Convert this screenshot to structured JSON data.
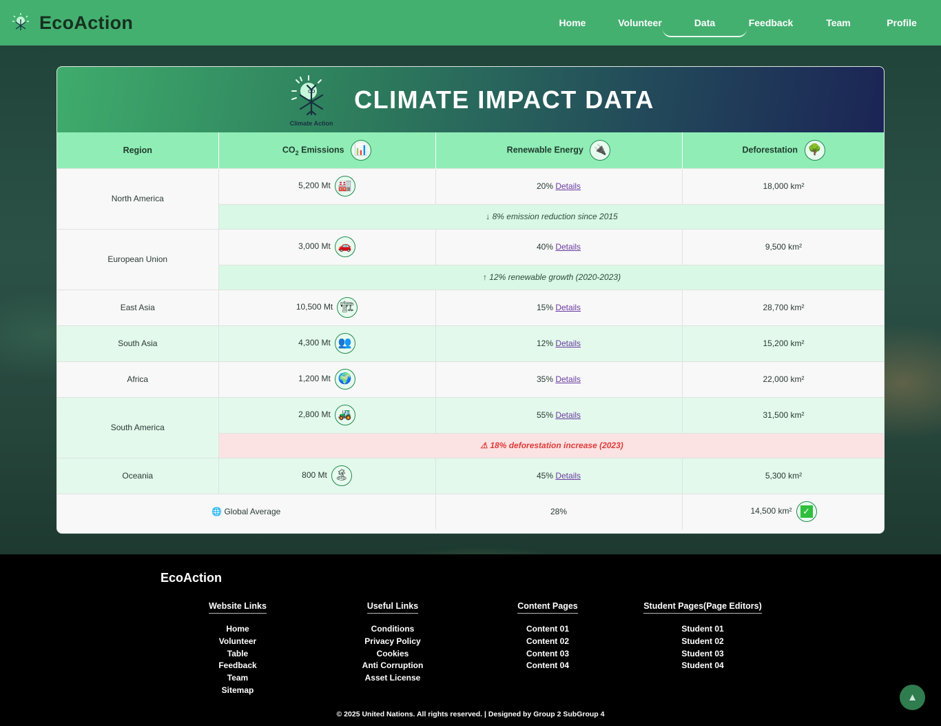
{
  "nav": {
    "brand": "EcoAction",
    "links": [
      "Home",
      "Volunteer",
      "Data",
      "Feedback",
      "Team",
      "Profile"
    ],
    "active": "Data"
  },
  "card": {
    "logo_text": "Climate Action",
    "title": "CLIMATE IMPACT DATA"
  },
  "table": {
    "headers": {
      "region": "Region",
      "co2_prefix": "CO",
      "co2_sub": "2",
      "co2_suffix": "Emissions",
      "renewable": "Renewable Energy",
      "deforestation": "Deforestation"
    },
    "link_label": "Details",
    "rows": [
      {
        "region": "North America",
        "co2": "5,200 Mt",
        "co2_icon": "factory-icon",
        "renewable": "20%",
        "deforestation": "18,000 km²",
        "note": "↓ 8% emission reduction since 2015"
      },
      {
        "region": "European Union",
        "co2": "3,000 Mt",
        "co2_icon": "car-icon",
        "renewable": "40%",
        "deforestation": "9,500 km²",
        "note": "↑ 12% renewable growth (2020-2023)"
      },
      {
        "region": "East Asia",
        "co2": "10,500 Mt",
        "co2_icon": "industry-icon",
        "renewable": "15%",
        "deforestation": "28,700 km²"
      },
      {
        "region": "South Asia",
        "co2": "4,300 Mt",
        "co2_icon": "people-icon",
        "renewable": "12%",
        "deforestation": "15,200 km²"
      },
      {
        "region": "Africa",
        "co2": "1,200 Mt",
        "co2_icon": "globe-icon",
        "renewable": "35%",
        "deforestation": "22,000 km²"
      },
      {
        "region": "South America",
        "co2": "2,800 Mt",
        "co2_icon": "tractor-icon",
        "renewable": "55%",
        "deforestation": "31,500 km²",
        "warning": "18% deforestation increase (2023)"
      },
      {
        "region": "Oceania",
        "co2": "800 Mt",
        "co2_icon": "palm-island-icon",
        "renewable": "45%",
        "deforestation": "5,300 km²"
      }
    ],
    "global": {
      "label": "Global Average",
      "renewable": "28%",
      "deforestation": "14,500 km²"
    }
  },
  "footer": {
    "brand": "EcoAction",
    "columns": [
      {
        "title": "Website Links",
        "items": [
          "Home",
          "Volunteer",
          "Table",
          "Feedback",
          "Team",
          "Sitemap"
        ]
      },
      {
        "title": "Useful Links",
        "items": [
          "Conditions",
          "Privacy Policy",
          "Cookies",
          "Anti Corruption",
          "Asset License"
        ]
      },
      {
        "title": "Content Pages",
        "items": [
          "Content 01",
          "Content 02",
          "Content 03",
          "Content 04"
        ]
      },
      {
        "title": "Student Pages(Page Editors)",
        "items": [
          "Student 01",
          "Student 02",
          "Student 03",
          "Student 04"
        ]
      }
    ],
    "copyright": "© 2025 United Nations. All rights reserved. | Designed by Group 2 SubGroup 4"
  },
  "colors": {
    "nav": "#44b070",
    "header_row": "#90edb6",
    "alt_row": "#e3f9ec",
    "warning": "#e03a3a"
  }
}
